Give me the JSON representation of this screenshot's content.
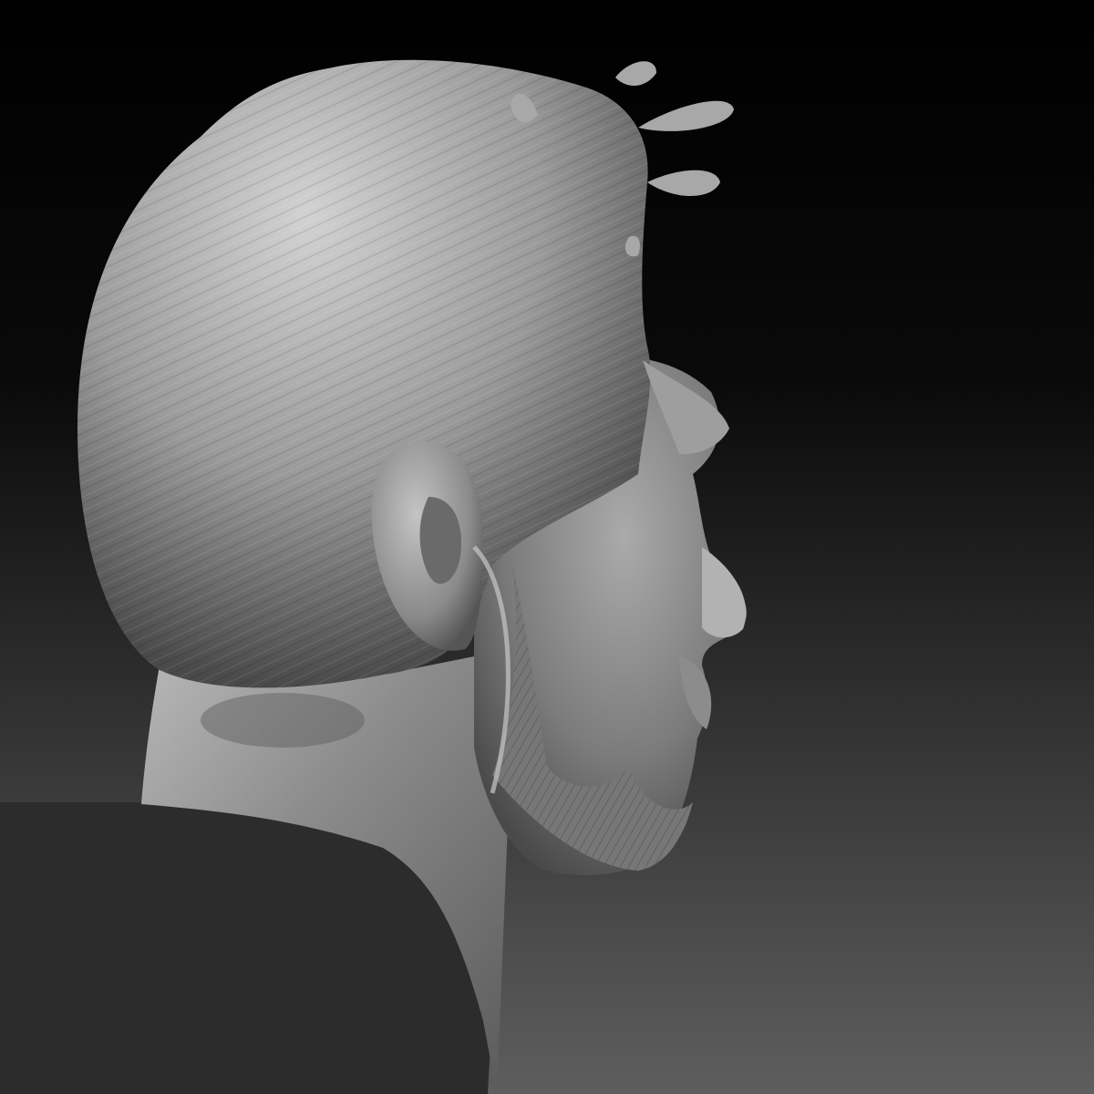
{
  "scene": {
    "subject": "sculpted-head-profile",
    "material": "matte-clay",
    "colors": {
      "background_top": "#000000",
      "background_bottom": "#5e5e5e",
      "clay_highlight": "#d2d2d2",
      "clay_mid": "#9a9a9a",
      "clay_shadow": "#4a4a4a",
      "cut_plane": "#2c2c2c"
    }
  }
}
